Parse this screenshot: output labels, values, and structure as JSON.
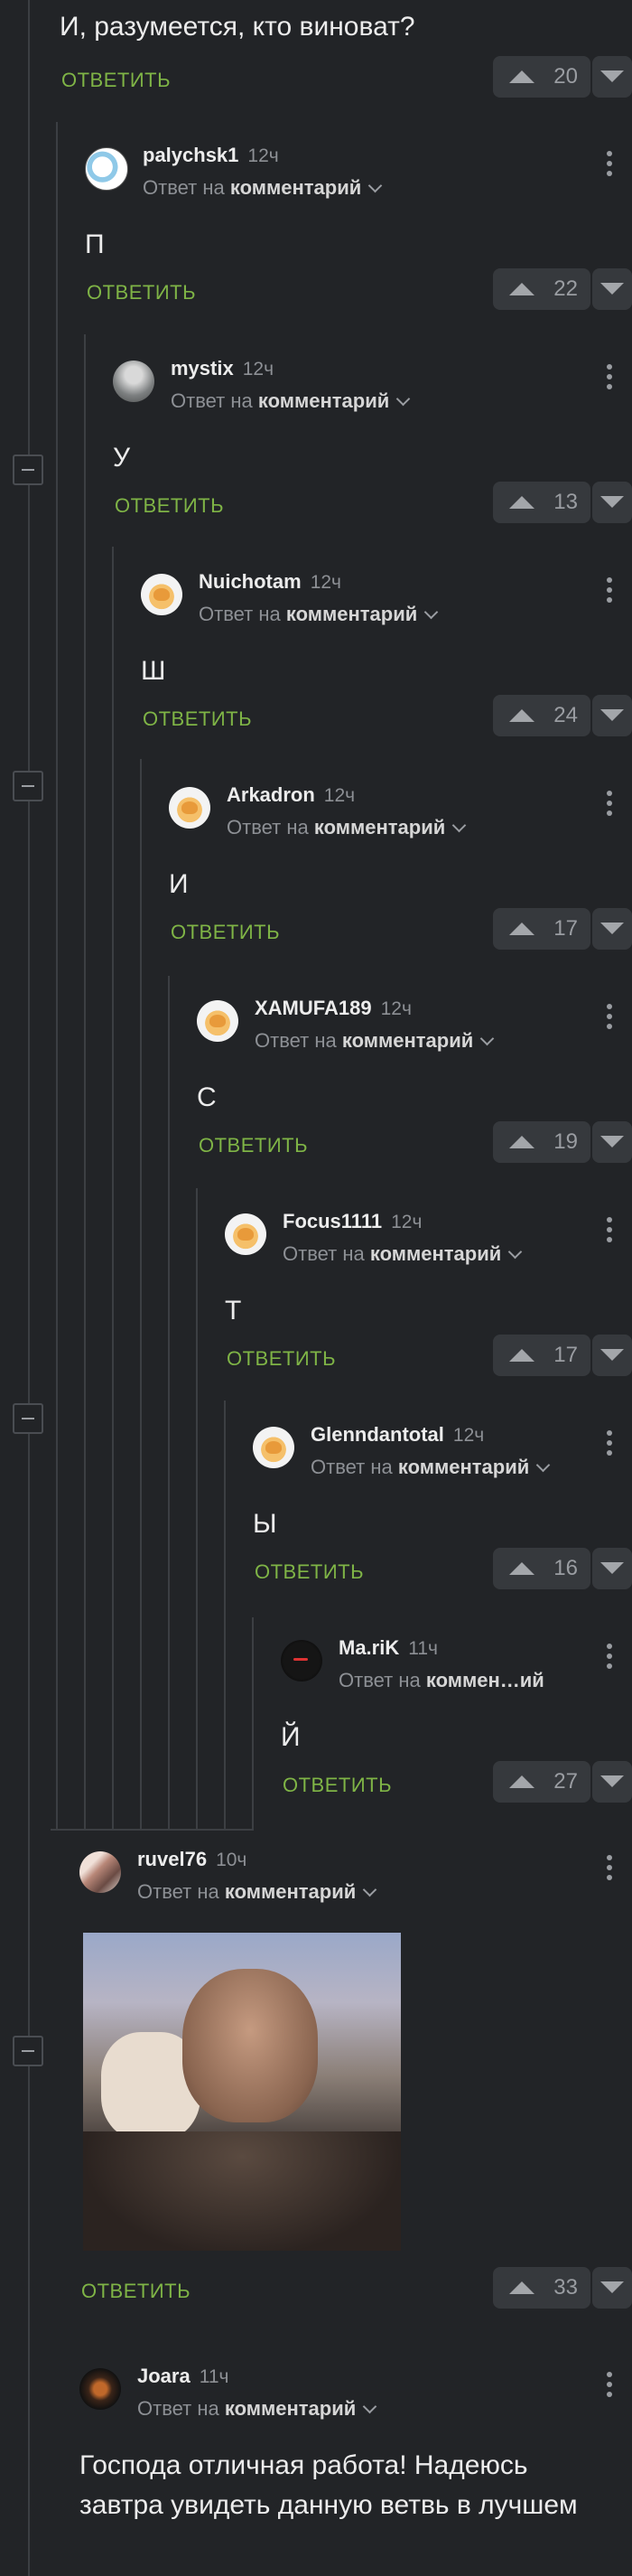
{
  "top_comment": {
    "text": "И, разумеется, кто виноват?",
    "reply_label": "ОТВЕТИТЬ",
    "votes": "20"
  },
  "comments": [
    {
      "username": "palychsk1",
      "time": "12ч",
      "reply_prefix": "Ответ на",
      "reply_target": "комментарий",
      "text": "П",
      "reply_label": "ОТВЕТИТЬ",
      "votes": "22",
      "avatar": "comic-avatar"
    },
    {
      "username": "mystix",
      "time": "12ч",
      "reply_prefix": "Ответ на",
      "reply_target": "комментарий",
      "text": "У",
      "reply_label": "ОТВЕТИТЬ",
      "votes": "13",
      "avatar": "gray-avatar"
    },
    {
      "username": "Nuichotam",
      "time": "12ч",
      "reply_prefix": "Ответ на",
      "reply_target": "комментарий",
      "text": "Ш",
      "reply_label": "ОТВЕТИТЬ",
      "votes": "24",
      "avatar": "cat-avatar"
    },
    {
      "username": "Arkadron",
      "time": "12ч",
      "reply_prefix": "Ответ на",
      "reply_target": "комментарий",
      "text": "И",
      "reply_label": "ОТВЕТИТЬ",
      "votes": "17",
      "avatar": "cat-avatar"
    },
    {
      "username": "XAMUFA189",
      "time": "12ч",
      "reply_prefix": "Ответ на",
      "reply_target": "комментарий",
      "text": "С",
      "reply_label": "ОТВЕТИТЬ",
      "votes": "19",
      "avatar": "cat-avatar"
    },
    {
      "username": "Focus1111",
      "time": "12ч",
      "reply_prefix": "Ответ на",
      "reply_target": "комментарий",
      "text": "Т",
      "reply_label": "ОТВЕТИТЬ",
      "votes": "17",
      "avatar": "cat-avatar"
    },
    {
      "username": "Glenndantotal",
      "time": "12ч",
      "reply_prefix": "Ответ на",
      "reply_target": "комментарий",
      "text": "Ы",
      "reply_label": "ОТВЕТИТЬ",
      "votes": "16",
      "avatar": "cat-avatar"
    },
    {
      "username": "Ma.riK",
      "time": "11ч",
      "reply_prefix": "Ответ на",
      "reply_target": "коммен…ий",
      "text": "Й",
      "reply_label": "ОТВЕТИТЬ",
      "votes": "27",
      "avatar": "dark-avatar"
    },
    {
      "username": "ruvel76",
      "time": "10ч",
      "reply_prefix": "Ответ на",
      "reply_target": "комментарий",
      "text": "",
      "reply_label": "ОТВЕТИТЬ",
      "votes": "33",
      "avatar": "face-avatar",
      "has_photo": true
    },
    {
      "username": "Joara",
      "time": "11ч",
      "reply_prefix": "Ответ на",
      "reply_target": "комментарий",
      "text": "Господа отличная работа! Надеюсь завтра увидеть данную ветвь в лучшем",
      "avatar": "joara-avatar"
    }
  ]
}
